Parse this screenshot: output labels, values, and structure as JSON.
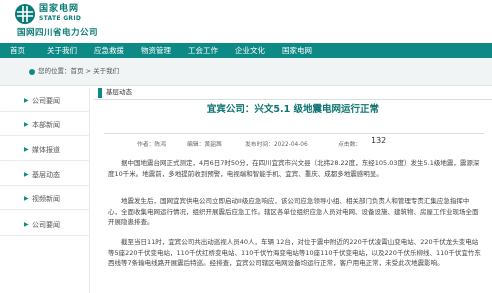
{
  "header": {
    "brand_cn": "国家电网",
    "brand_en": "STATE GRID",
    "sub_brand": "国网四川省电力公司",
    "brand_color": "#0a7b78"
  },
  "nav": {
    "color": "#0e8a86",
    "items": [
      "首页",
      "关于我们",
      "应急救援",
      "物资管理",
      "工会工作",
      "企业文化",
      "国家电网"
    ]
  },
  "breadcrumb": {
    "text": "您的位置：首页 > 关于我们"
  },
  "sidebar": {
    "items": [
      {
        "icon": "arrow-icon",
        "label": "公司要闻"
      },
      {
        "icon": "arrow-icon",
        "label": "本部新闻"
      },
      {
        "icon": "arrow-icon",
        "label": "媒体报道"
      },
      {
        "icon": "arrow-icon",
        "label": "基层动态"
      },
      {
        "icon": "arrow-icon",
        "label": "视频新闻"
      },
      {
        "icon": "arrow-icon",
        "label": "公司要闻"
      }
    ]
  },
  "section": {
    "title": "基层动态"
  },
  "article": {
    "title": "宜宾公司：兴文5.1 级地震电网运行正常",
    "meta": {
      "author": "作者：陈鸿",
      "editor": "编辑：黄韶茜",
      "time": "发布时间：2022-04-06",
      "views_label": "点击数：",
      "views": "132"
    },
    "paragraphs": [
      "据中国地震台网正式测定，4月6日7时50分，在四川宜宾市兴文县（北纬28.22度，东经105.03度）发生5.1级地震，震源深度10千米。地震前，多地提前收到预警，电视端和智能手机、宜宾、重庆、成都多地震感明显。",
      "地震发生后，国网宜宾供电公司立即启动II级应急响应，该公司应急领导小组、相关部门负责人和管理专责汇集应急指挥中心，全面收集电网运行情况，组织开展震后应急工作。辖区各单位组织应急人员对电网、设备设施、建筑物、房屋工作业现场全面开展隐患排查。",
      "截至当日11时，宜宾公司共出动巡视人员40人，车辆 12台，对位于震中附近的220千伏凌霄山变电站、220千伏龙头变电站等5座220千伏变电站，110千伏红桥变电站、110千伏竹海变电站等10座110千伏变电站，以及220千伏乐柳线、110千伏宜竹东西线等7条输电线路开展震后特巡。经排查，宜宾公司辖区电网设备均运行正常，客户用电正常，未受此次地震影响。"
    ]
  }
}
